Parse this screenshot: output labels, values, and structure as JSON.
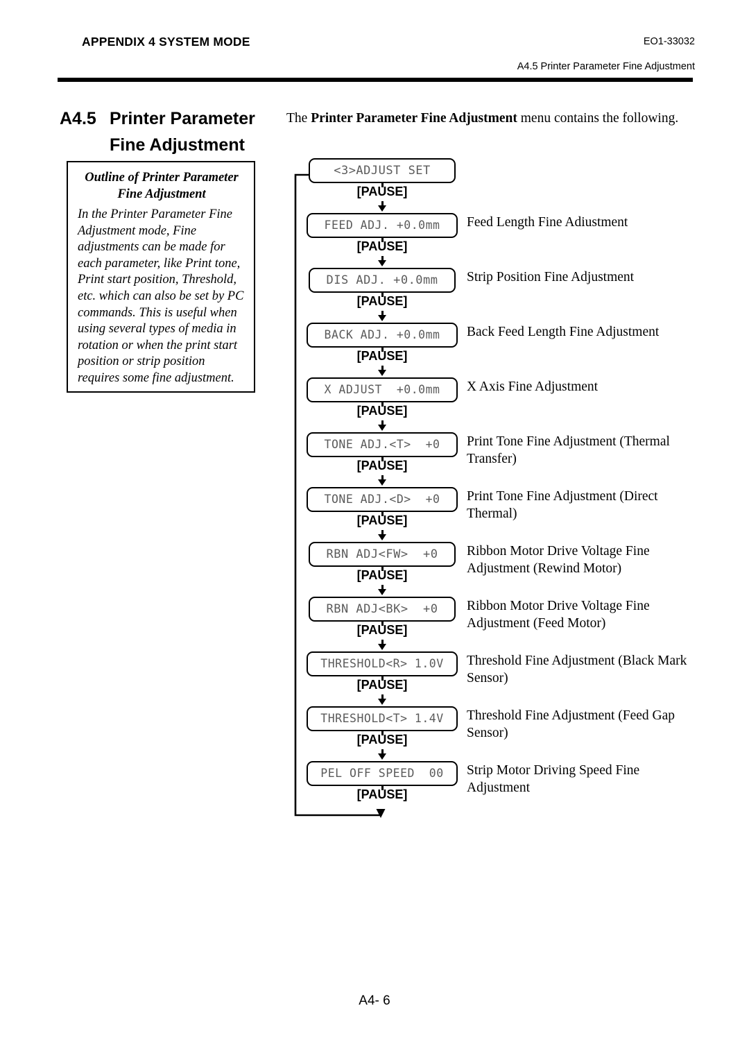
{
  "header": {
    "left_title": "APPENDIX 4 SYSTEM MODE",
    "doc_code": "EO1-33032",
    "subtitle": "A4.5 Printer Parameter Fine Adjustment"
  },
  "section": {
    "number": "A4.5",
    "title_line1": "Printer Parameter",
    "title_line2": "Fine Adjustment"
  },
  "intro": {
    "prefix": "The ",
    "bold": "Printer Parameter Fine Adjustment",
    "suffix": " menu contains the following."
  },
  "outline": {
    "heading_line1": "Outline of Printer Parameter",
    "heading_line2": "Fine Adjustment",
    "body": "In the Printer Parameter Fine Adjustment mode, Fine adjustments can be made for each parameter, like Print tone, Print start position, Threshold, etc. which can also be set by PC commands. This is useful when using several types of media in rotation or when the print start position or strip position requires some fine adjustment."
  },
  "flow": {
    "key_label": "[PAUSE]",
    "steps": [
      {
        "lcd": "<3>ADJUST SET",
        "desc": ""
      },
      {
        "lcd": "FEED ADJ. +0.0mm",
        "desc": "Feed Length Fine Adiustment"
      },
      {
        "lcd": "DIS ADJ. +0.0mm",
        "desc": "Strip Position Fine Adjustment"
      },
      {
        "lcd": "BACK ADJ. +0.0mm",
        "desc": "Back Feed Length Fine Adjustment"
      },
      {
        "lcd": "X ADJUST  +0.0mm",
        "desc": "X Axis Fine Adjustment"
      },
      {
        "lcd": "TONE ADJ.<T>  +0",
        "desc": "Print Tone Fine Adjustment (Thermal Transfer)"
      },
      {
        "lcd": "TONE ADJ.<D>  +0",
        "desc": "Print Tone Fine Adjustment (Direct Thermal)"
      },
      {
        "lcd": "RBN ADJ<FW>  +0",
        "desc": "Ribbon Motor Drive Voltage Fine Adjustment (Rewind Motor)"
      },
      {
        "lcd": "RBN ADJ<BK>  +0",
        "desc": "Ribbon Motor Drive Voltage Fine Adjustment (Feed Motor)"
      },
      {
        "lcd": "THRESHOLD<R> 1.0V",
        "desc": "Threshold Fine Adjustment (Black Mark Sensor)"
      },
      {
        "lcd": "THRESHOLD<T> 1.4V",
        "desc": "Threshold Fine Adjustment (Feed Gap Sensor)"
      },
      {
        "lcd": "PEL OFF SPEED  00",
        "desc": "Strip Motor Driving Speed Fine Adjustment"
      }
    ]
  },
  "footer": {
    "page_number": "A4- 6"
  },
  "colors": {
    "ink": "#000000",
    "lcd_text": "#5b5b5b",
    "paper": "#ffffff"
  }
}
